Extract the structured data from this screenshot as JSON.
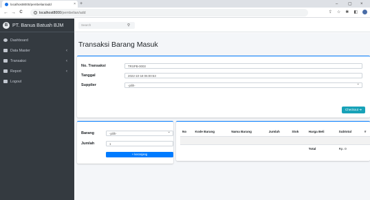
{
  "browser": {
    "tab_title": "localhost8000/pembelian/add",
    "new_tab": "+",
    "url_host": "localhost8000",
    "url_path": "/pembelian/add",
    "back": "←",
    "forward": "→",
    "reload": "C",
    "tab_close": "×",
    "minimize": "–",
    "maximize": "▢",
    "close": "×",
    "share": "⇪",
    "star": "☆",
    "extensions": "✱",
    "sidepanel": "◧"
  },
  "sidebar": {
    "brand_logo": "B",
    "brand": "PT. Banua Batuah BJM",
    "items": [
      {
        "label": "Dashboard",
        "icon": "dashboard-icon",
        "chevron": ""
      },
      {
        "label": "Data Master",
        "icon": "table-icon",
        "chevron": "‹"
      },
      {
        "label": "Transaksi",
        "icon": "table-icon",
        "chevron": "‹"
      },
      {
        "label": "Report",
        "icon": "table-icon",
        "chevron": "‹"
      },
      {
        "label": "Logout",
        "icon": "logout-icon",
        "chevron": ""
      }
    ]
  },
  "topnav": {
    "search_placeholder": "Search",
    "search_icon": "⚲"
  },
  "page": {
    "title": "Transaksi Barang Masuk"
  },
  "form": {
    "no_transaksi_label": "No. Transaksi",
    "no_transaksi_value": "TRSPB-0003",
    "tanggal_label": "Tanggal",
    "tanggal_value": "2022-10-18 06:00:53",
    "supplier_label": "Supplier",
    "supplier_value": "-pilih-",
    "checkout_label": "Checkout ➜"
  },
  "cart_form": {
    "barang_label": "Barang",
    "barang_value": "-pilih-",
    "jumlah_label": "Jumlah",
    "jumlah_value": "1",
    "keranjang_label": "+ keranjang"
  },
  "cart_table": {
    "headers": [
      "No",
      "Kode Barang",
      "Nama Barang",
      "Jumlah",
      "Stok",
      "Harga Beli",
      "Subtotal",
      "#"
    ],
    "total_label": "Total",
    "total_value": "Rp. 0"
  },
  "colors": {
    "sidebar_bg": "#343a40",
    "primary": "#007bff",
    "info": "#17a2b8",
    "content_bg": "#f4f6f9"
  }
}
